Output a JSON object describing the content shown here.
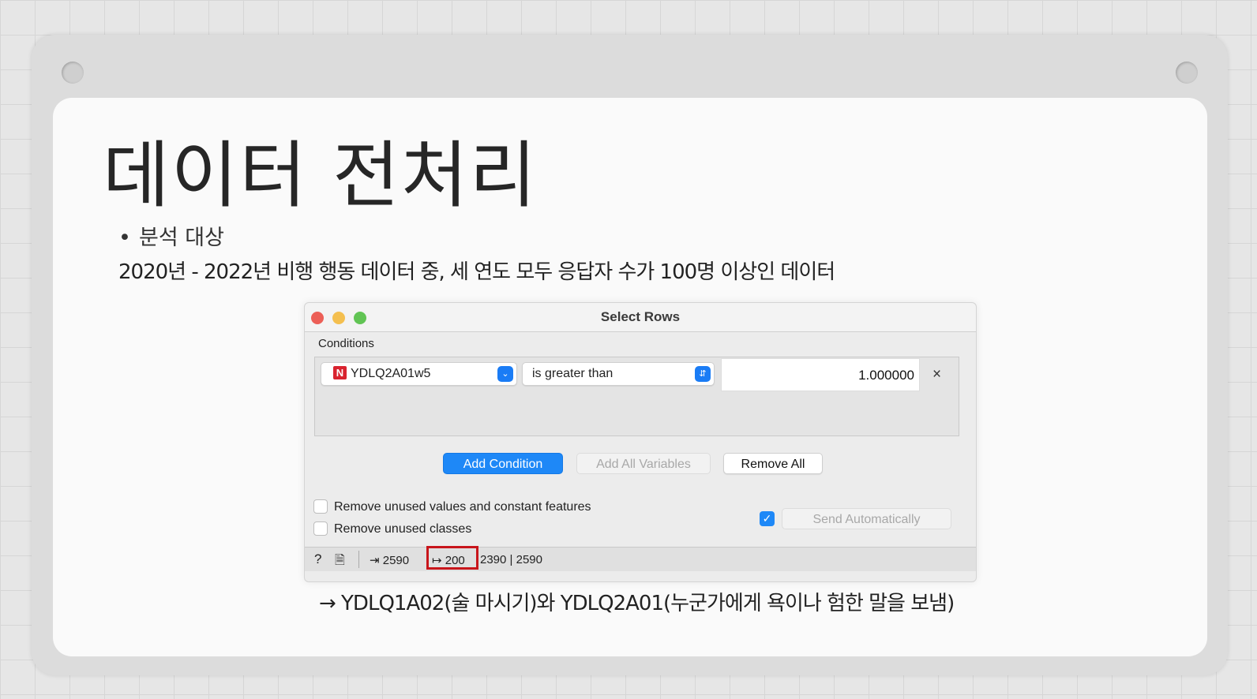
{
  "slide": {
    "title": "데이터 전처리",
    "bullet": "분석 대상",
    "description": "2020년 -  2022년 비행 행동 데이터 중, 세 연도 모두 응답자 수가 100명 이상인 데이터",
    "caption": "→ YDLQ1A02(술 마시기)와 YDLQ2A01(누군가에게 욕이나 험한 말을 보냄)"
  },
  "dialog": {
    "title": "Select Rows",
    "conditions_label": "Conditions",
    "condition": {
      "variable_badge": "N",
      "variable": "YDLQ2A01w5",
      "operator": "is greater than",
      "value": "1.000000",
      "remove_glyph": "×"
    },
    "buttons": {
      "add_condition": "Add Condition",
      "add_all_variables": "Add All Variables",
      "remove_all": "Remove All"
    },
    "options": {
      "remove_unused_values": "Remove unused values and constant features",
      "remove_unused_classes": "Remove unused classes",
      "send_automatically": "Send Automatically",
      "send_automatically_checked": true
    },
    "status_bar": {
      "input_count": "2590",
      "output_count": "200",
      "counts_text": "2390 | 2590"
    }
  },
  "colors": {
    "accent_blue": "#1e88f7",
    "highlight_red": "#c8151b",
    "badge_red": "#d9232f"
  }
}
